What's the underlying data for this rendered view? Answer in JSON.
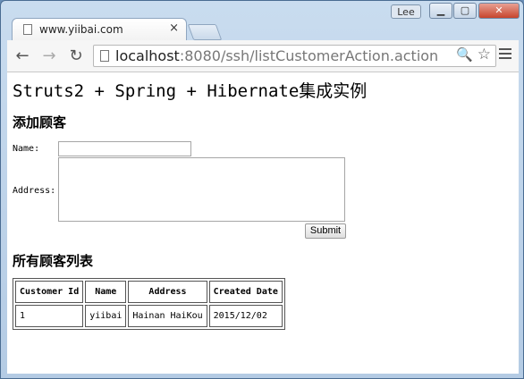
{
  "browser": {
    "tab_title": "www.yiibai.com",
    "tab_close": "×",
    "user_badge": "Lee",
    "window_controls": {
      "minimize": "▁",
      "maximize": "▢",
      "close": "✕"
    },
    "nav": {
      "back": "←",
      "forward": "→",
      "reload": "↻"
    },
    "url_host": "localhost",
    "url_rest": ":8080/ssh/listCustomerAction.action",
    "icons": {
      "page": "page-icon",
      "zoom": "🔍",
      "star": "☆",
      "menu": "menu-icon"
    }
  },
  "page": {
    "title": "Struts2 + Spring + Hibernate集成实例",
    "add_heading": "添加顾客",
    "name_label": "Name:",
    "address_label": "Address:",
    "submit_label": "Submit",
    "list_heading": "所有顾客列表"
  },
  "table": {
    "headers": [
      "Customer Id",
      "Name",
      "Address",
      "Created Date"
    ],
    "rows": [
      [
        "1",
        "yiibai",
        "Hainan HaiKou",
        "2015/12/02"
      ]
    ]
  }
}
